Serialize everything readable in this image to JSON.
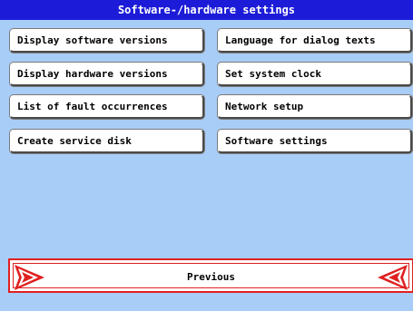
{
  "title": "Software-/hardware settings",
  "left_buttons": [
    {
      "label": "Display software versions"
    },
    {
      "label": "Display hardware versions"
    },
    {
      "label": "List of fault occurrences"
    },
    {
      "label": "Create service disk"
    }
  ],
  "right_buttons": [
    {
      "label": "Language for dialog texts"
    },
    {
      "label": "Set system clock"
    },
    {
      "label": "Network setup"
    },
    {
      "label": "Software settings"
    }
  ],
  "previous": {
    "label": "Previous"
  },
  "colors": {
    "background": "#a8cdf7",
    "titlebar": "#1c1cd8",
    "accent": "#e02020"
  }
}
